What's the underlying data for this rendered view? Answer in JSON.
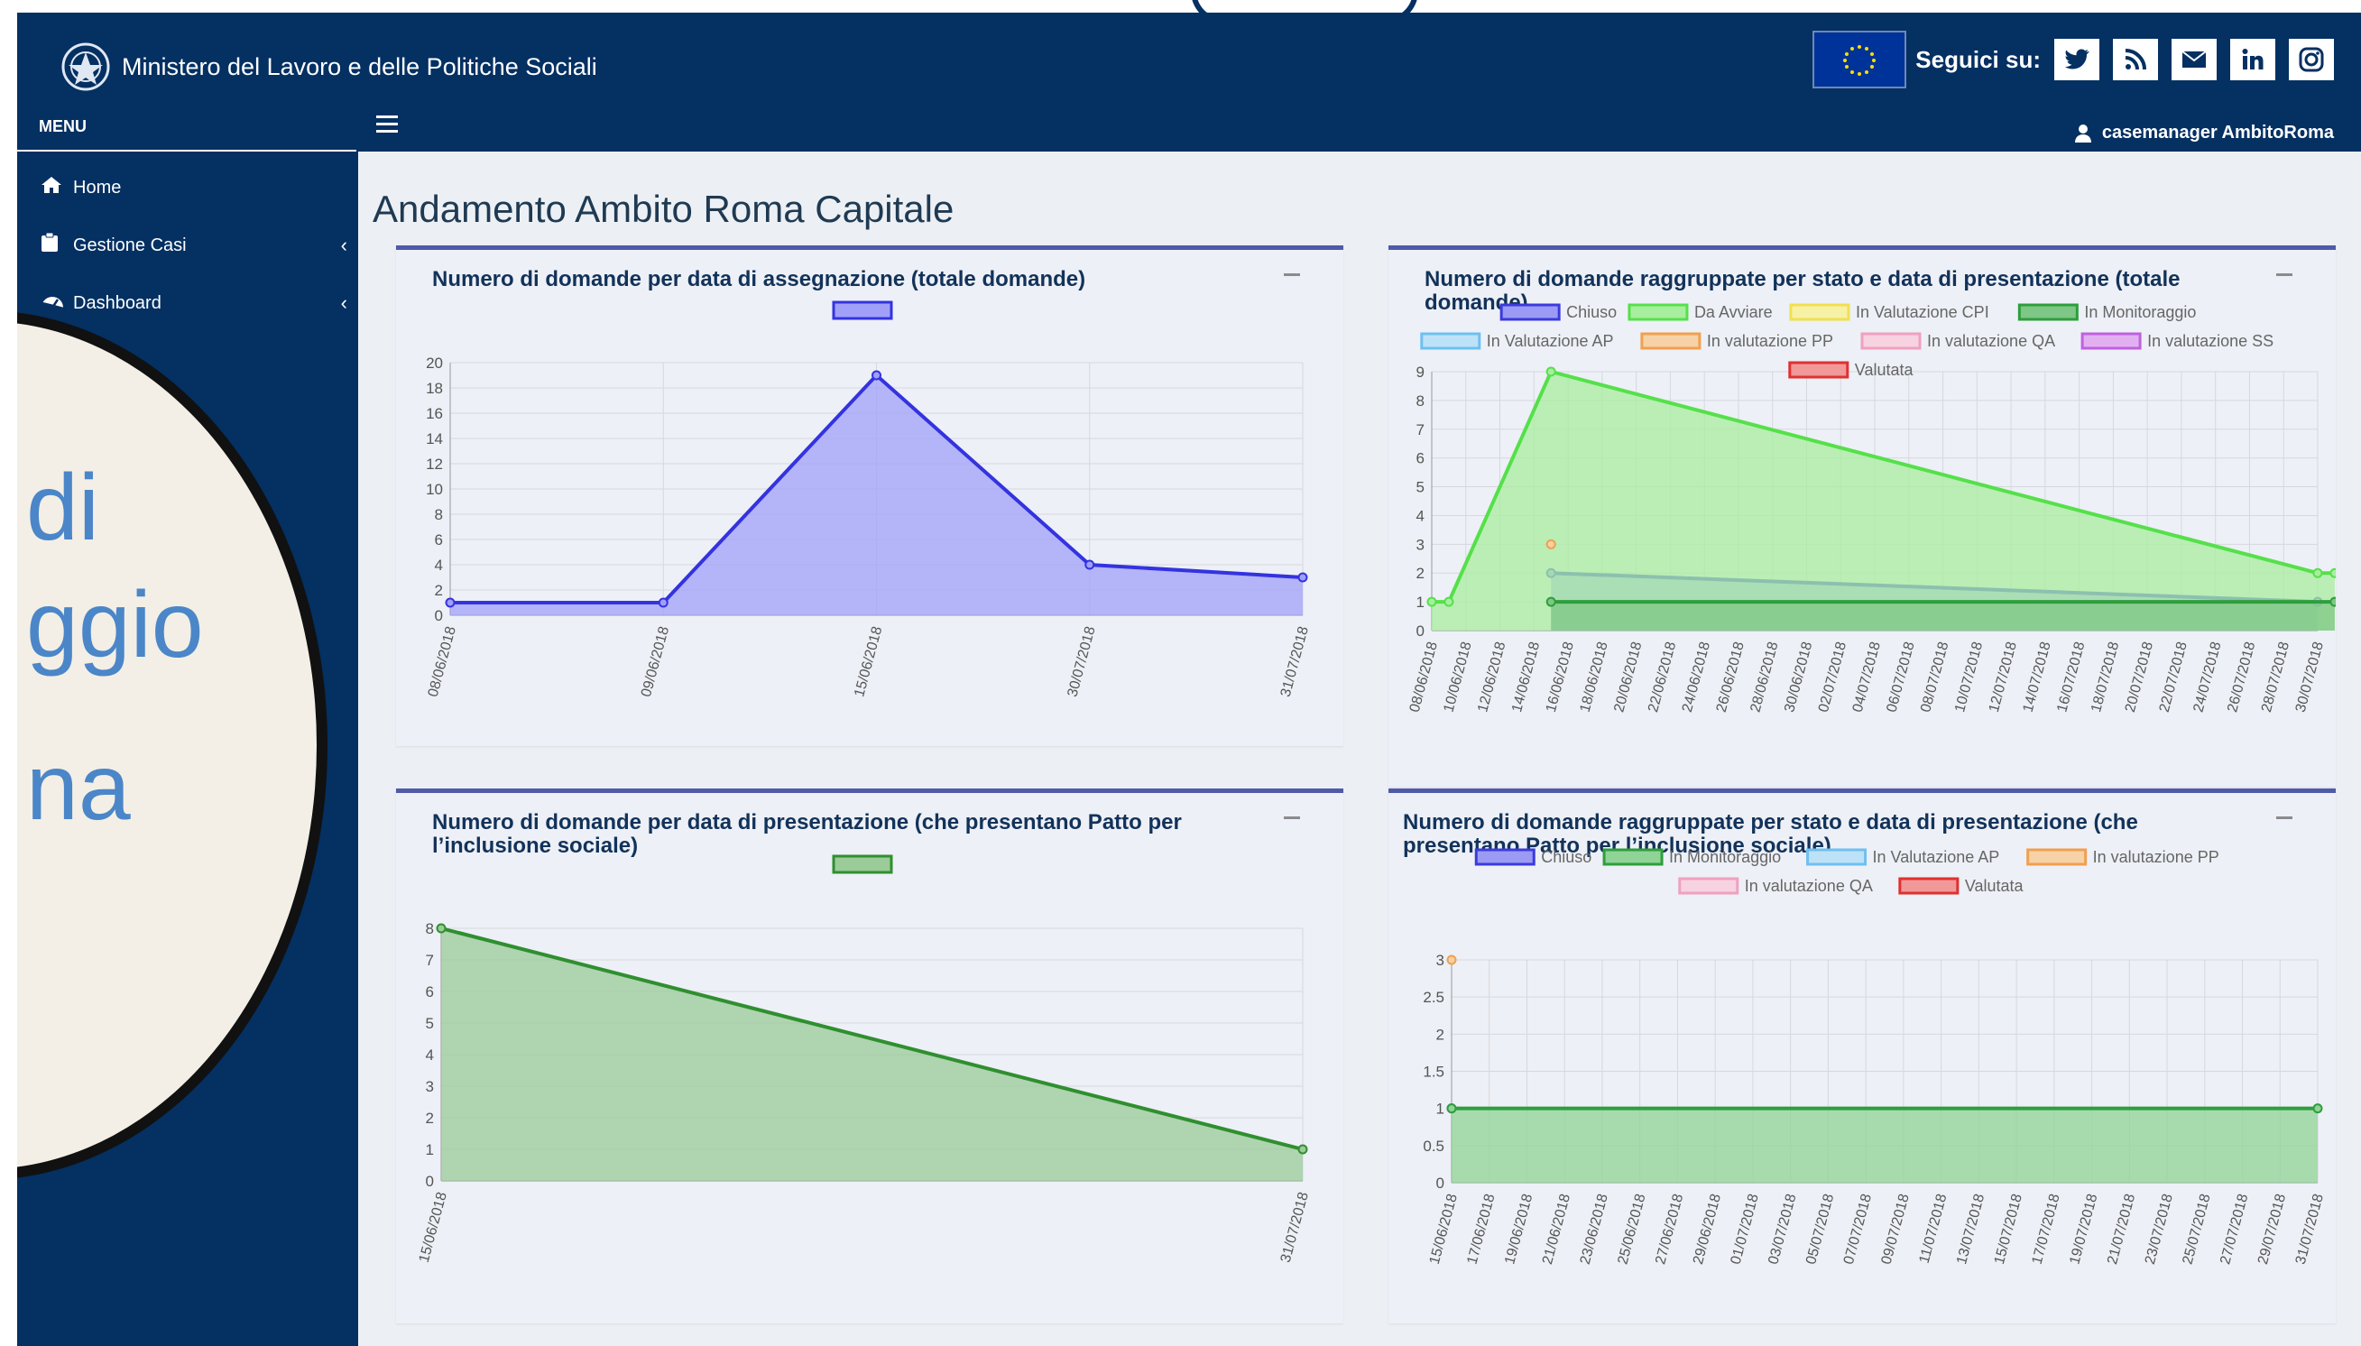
{
  "header": {
    "ministry": "Ministero del Lavoro e delle Politiche Sociali",
    "follow_label": "Seguici su:",
    "social": [
      "twitter-icon",
      "rss-icon",
      "mail-icon",
      "linkedin-icon",
      "instagram-icon"
    ],
    "user": "casemanager AmbitoRoma",
    "colors": {
      "navy": "#043062"
    }
  },
  "sidebar": {
    "menu_label": "MENU",
    "items": [
      {
        "label": "Home",
        "icon": "home-icon",
        "expandable": false
      },
      {
        "label": "Gestione Casi",
        "icon": "clipboard-icon",
        "expandable": true
      },
      {
        "label": "Dashboard",
        "icon": "dashboard-icon",
        "expandable": true
      }
    ]
  },
  "overlay": {
    "lines": [
      "di",
      "ggio",
      "na"
    ]
  },
  "main": {
    "title": "Andamento Ambito Roma Capitale",
    "boxes": [
      "Numero di domande per data di assegnazione (totale domande)",
      "Numero di domande raggruppate per stato e data di presentazione (totale domande)",
      "Numero di domande per data di presentazione (che presentano Patto per l’inclusione sociale)",
      "Numero di domande raggruppate per stato e data di presentazione (che presentano Patto per l’inclusione sociale)"
    ]
  },
  "chart_data": [
    {
      "type": "area",
      "title": "Numero di domande per data di assegnazione (totale domande)",
      "categories": [
        "08/06/2018",
        "09/06/2018",
        "15/06/2018",
        "30/07/2018",
        "31/07/2018"
      ],
      "series": [
        {
          "values": [
            1,
            1,
            19,
            4,
            3
          ],
          "color": "#3333e0",
          "fill": "#a0a0f8"
        }
      ],
      "ylim": [
        0,
        20
      ],
      "yticks": [
        0,
        2,
        4,
        6,
        8,
        10,
        12,
        14,
        16,
        18,
        20
      ],
      "legend": "top",
      "grid": true
    },
    {
      "type": "area",
      "title": "Numero di domande raggruppate per stato e data di presentazione (totale domande)",
      "categories": [
        "08/06/2018",
        "10/06/2018",
        "12/06/2018",
        "14/06/2018",
        "16/06/2018",
        "18/06/2018",
        "20/06/2018",
        "22/06/2018",
        "24/06/2018",
        "26/06/2018",
        "28/06/2018",
        "30/06/2018",
        "02/07/2018",
        "04/07/2018",
        "06/07/2018",
        "08/07/2018",
        "10/07/2018",
        "12/07/2018",
        "14/07/2018",
        "16/07/2018",
        "18/07/2018",
        "20/07/2018",
        "22/07/2018",
        "24/07/2018",
        "26/07/2018",
        "28/07/2018",
        "30/07/2018"
      ],
      "series": [
        {
          "name": "Chiuso",
          "color": "#3b3bdc",
          "fill": "#9b9bf5",
          "points": [
            [
              "15/06/2018",
              2
            ],
            [
              "30/07/2018",
              1
            ]
          ]
        },
        {
          "name": "Da Avviare",
          "color": "#55e04a",
          "fill": "#a8ee9f",
          "points": [
            [
              "08/06/2018",
              1
            ],
            [
              "09/06/2018",
              1
            ],
            [
              "15/06/2018",
              9
            ],
            [
              "30/07/2018",
              2
            ],
            [
              "31/07/2018",
              2
            ]
          ]
        },
        {
          "name": "In Valutazione CPI",
          "color": "#f0e050",
          "fill": "#f7f1a6",
          "points": []
        },
        {
          "name": "In Monitoraggio",
          "color": "#2e9e3c",
          "fill": "#7fc786",
          "points": [
            [
              "15/06/2018",
              1
            ],
            [
              "31/07/2018",
              1
            ]
          ]
        },
        {
          "name": "In Valutazione AP",
          "color": "#6ec0f0",
          "fill": "#bde2f7",
          "points": []
        },
        {
          "name": "In valutazione PP",
          "color": "#f0a050",
          "fill": "#f7d2a6",
          "points": [
            [
              "15/06/2018",
              3
            ]
          ]
        },
        {
          "name": "In valutazione QA",
          "color": "#f0a0c0",
          "fill": "#f7d2e0",
          "points": []
        },
        {
          "name": "In valutazione SS",
          "color": "#c060e0",
          "fill": "#e2b0f0",
          "points": []
        },
        {
          "name": "Valutata",
          "color": "#e03030",
          "fill": "#f19898",
          "points": []
        }
      ],
      "ylim": [
        0,
        9
      ],
      "yticks": [
        0,
        1,
        2,
        3,
        4,
        5,
        6,
        7,
        8,
        9
      ],
      "legend": "top",
      "grid": true
    },
    {
      "type": "area",
      "title": "Numero di domande per data di presentazione (che presentano Patto per l’inclusione sociale)",
      "categories": [
        "15/06/2018",
        "31/07/2018"
      ],
      "series": [
        {
          "values": [
            8,
            1
          ],
          "color": "#2f8f2f",
          "fill": "#9acb98"
        }
      ],
      "ylim": [
        0,
        8
      ],
      "yticks": [
        0,
        1,
        2,
        3,
        4,
        5,
        6,
        7,
        8
      ],
      "legend": "top",
      "grid": true
    },
    {
      "type": "area",
      "title": "Numero di domande raggruppate per stato e data di presentazione (che presentano Patto per l’inclusione sociale)",
      "categories": [
        "15/06/2018",
        "17/06/2018",
        "19/06/2018",
        "21/06/2018",
        "23/06/2018",
        "25/06/2018",
        "27/06/2018",
        "29/06/2018",
        "01/07/2018",
        "03/07/2018",
        "05/07/2018",
        "07/07/2018",
        "09/07/2018",
        "11/07/2018",
        "13/07/2018",
        "15/07/2018",
        "17/07/2018",
        "19/07/2018",
        "21/07/2018",
        "23/07/2018",
        "25/07/2018",
        "27/07/2018",
        "29/07/2018",
        "31/07/2018"
      ],
      "series": [
        {
          "name": "Chiuso",
          "color": "#3b3bdc",
          "fill": "#9b9bf5",
          "points": [
            [
              "15/06/2018",
              1
            ]
          ]
        },
        {
          "name": "In Monitoraggio",
          "color": "#2e9e3c",
          "fill": "#8fd496",
          "points": [
            [
              "15/06/2018",
              1
            ],
            [
              "31/07/2018",
              1
            ]
          ]
        },
        {
          "name": "In Valutazione AP",
          "color": "#6ec0f0",
          "fill": "#bde2f7",
          "points": []
        },
        {
          "name": "In valutazione PP",
          "color": "#f0a050",
          "fill": "#f7d2a6",
          "points": [
            [
              "15/06/2018",
              3
            ]
          ]
        },
        {
          "name": "In valutazione QA",
          "color": "#f0a0c0",
          "fill": "#f7d2e0",
          "points": []
        },
        {
          "name": "Valutata",
          "color": "#e03030",
          "fill": "#f19898",
          "points": []
        }
      ],
      "ylim": [
        0,
        3
      ],
      "yticks": [
        0,
        0.5,
        1.0,
        1.5,
        2.0,
        2.5,
        3.0
      ],
      "legend": "top",
      "grid": true
    }
  ]
}
